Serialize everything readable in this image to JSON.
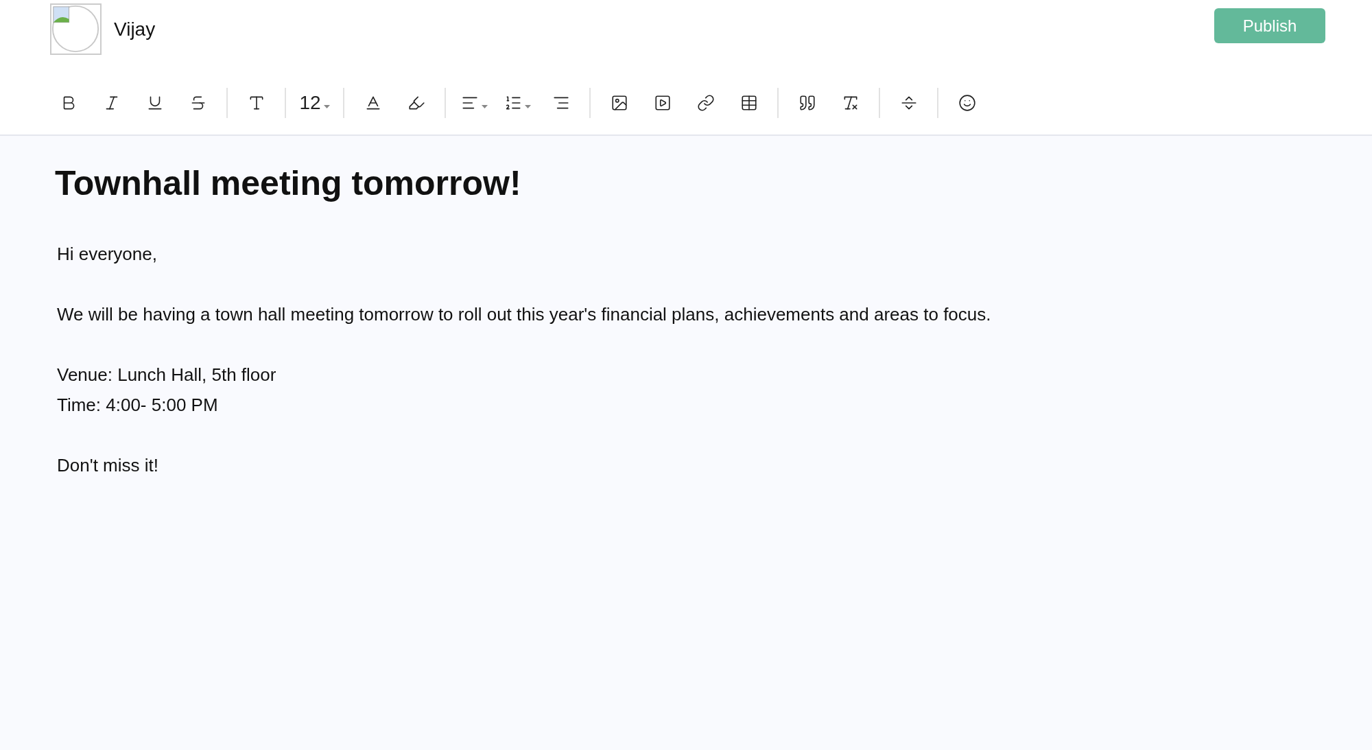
{
  "header": {
    "user_name": "Vijay",
    "publish_button": "Publish"
  },
  "toolbar": {
    "font_size": "12"
  },
  "document": {
    "title": "Townhall meeting tomorrow!",
    "blocks": [
      [
        "Hi everyone,"
      ],
      [
        "We will be having a town hall meeting tomorrow to roll out this year's financial plans, achievements and areas to focus."
      ],
      [
        "Venue: Lunch Hall, 5th floor",
        "Time: 4:00- 5:00 PM"
      ],
      [
        "Don't miss it!"
      ]
    ]
  }
}
